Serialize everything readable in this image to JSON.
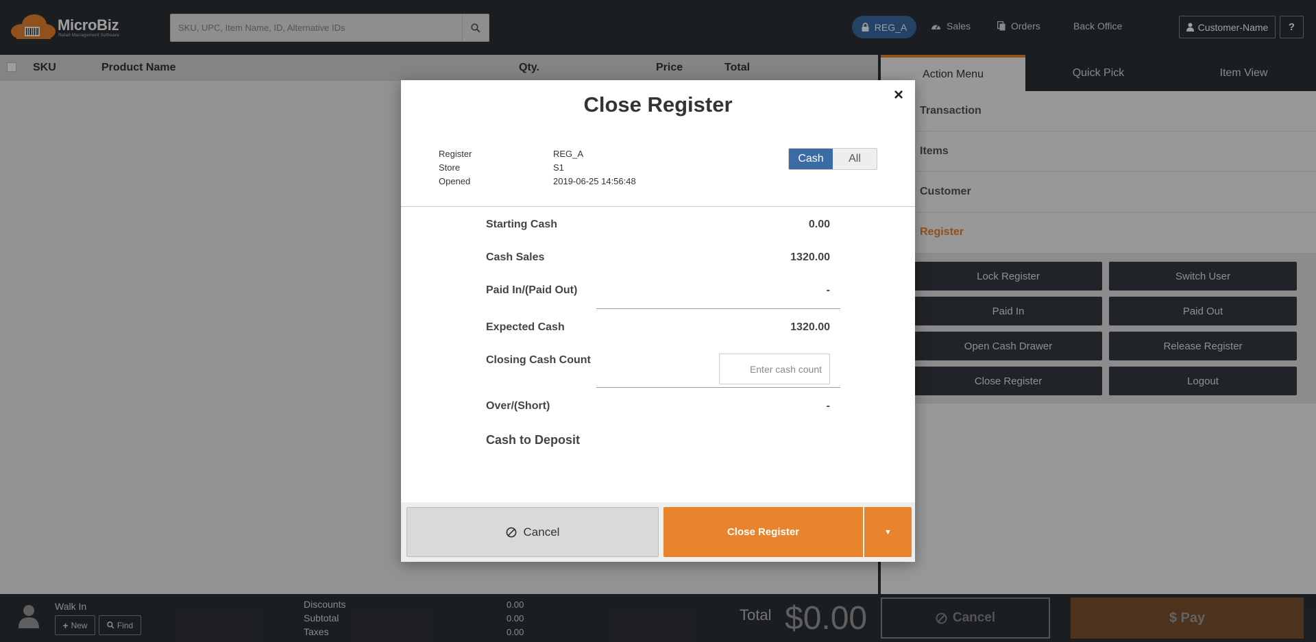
{
  "header": {
    "brand": "MicroBiz",
    "tagline": "Retail Management Software",
    "search_placeholder": "SKU, UPC, Item Name, ID, Alternative IDs",
    "register_pill": "REG_A",
    "nav": {
      "sales": "Sales",
      "orders": "Orders",
      "back_office": "Back Office"
    },
    "customer_button": "Customer-Name",
    "help": "?"
  },
  "cart": {
    "columns": {
      "sku": "SKU",
      "product": "Product Name",
      "qty": "Qty.",
      "price": "Price",
      "total": "Total"
    }
  },
  "right_panel": {
    "tabs": [
      "Action Menu",
      "Quick Pick",
      "Item View"
    ],
    "sections": [
      "Transaction",
      "Items",
      "Customer",
      "Register"
    ],
    "register_buttons": [
      "Lock Register",
      "Switch User",
      "Paid In",
      "Paid Out",
      "Open Cash Drawer",
      "Release Register",
      "Close Register",
      "Logout"
    ]
  },
  "footer": {
    "customer": "Walk In",
    "new": "New",
    "find": "Find",
    "totals": [
      {
        "label": "Discounts",
        "value": "0.00"
      },
      {
        "label": "Subtotal",
        "value": "0.00"
      },
      {
        "label": "Taxes",
        "value": "0.00"
      }
    ],
    "total_label": "Total",
    "total_value": "$0.00",
    "cancel": "Cancel",
    "pay": "$ Pay"
  },
  "modal": {
    "title": "Close Register",
    "close_symbol": "×",
    "info": [
      {
        "label": "Register",
        "value": "REG_A"
      },
      {
        "label": "Store",
        "value": "S1"
      },
      {
        "label": "Opened",
        "value": "2019-06-25 14:56:48"
      }
    ],
    "toggle": {
      "cash": "Cash",
      "all": "All"
    },
    "rows": {
      "starting_cash": {
        "label": "Starting Cash",
        "value": "0.00"
      },
      "cash_sales": {
        "label": "Cash Sales",
        "value": "1320.00"
      },
      "paid_in_out": {
        "label": "Paid In/(Paid Out)",
        "value": "-"
      },
      "expected_cash": {
        "label": "Expected Cash",
        "value": "1320.00"
      },
      "closing_count": {
        "label": "Closing Cash Count",
        "placeholder": "Enter cash count"
      },
      "over_short": {
        "label": "Over/(Short)",
        "value": "-"
      },
      "deposit": {
        "label": "Cash to Deposit"
      }
    },
    "cancel": "Cancel",
    "close_register": "Close Register"
  },
  "colors": {
    "header_bg": "#2d3136",
    "accent_orange": "#e8832e",
    "accent_blue": "#3b6aa5"
  }
}
